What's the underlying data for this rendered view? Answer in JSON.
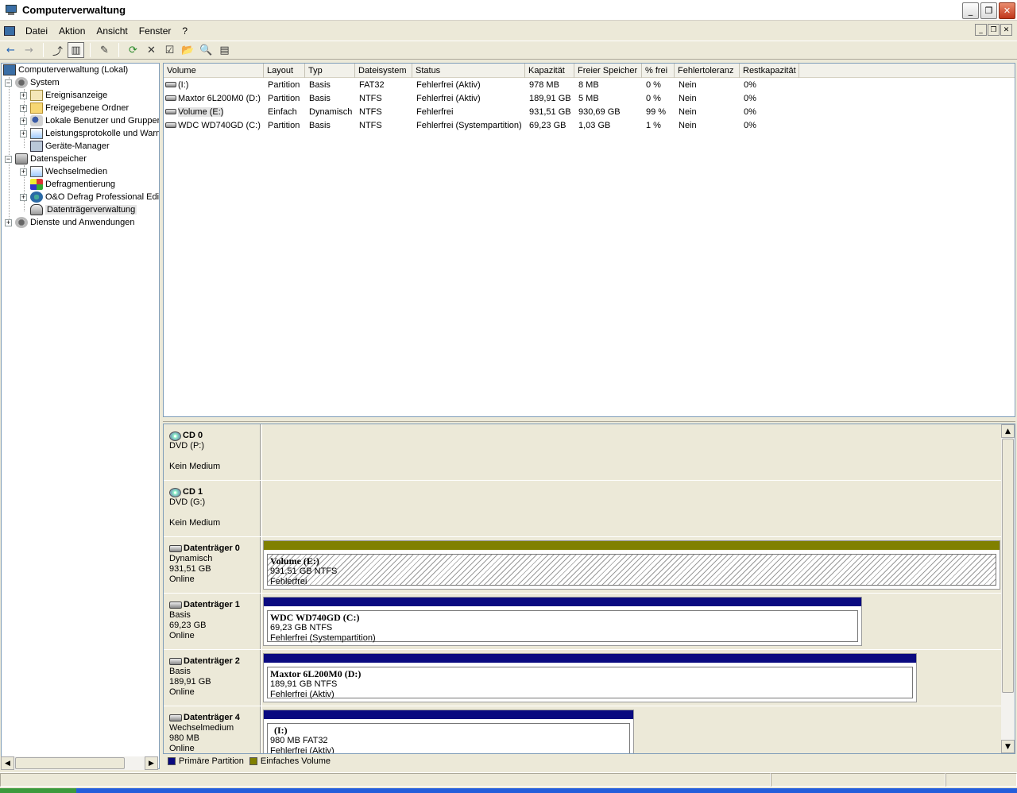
{
  "window": {
    "title": "Computerverwaltung",
    "minimize_glyph": "_",
    "restore_glyph": "❐",
    "close_glyph": "✕"
  },
  "menu": {
    "items": [
      "Datei",
      "Aktion",
      "Ansicht",
      "Fenster",
      "?"
    ],
    "mdi_minimize": "_",
    "mdi_restore": "❐",
    "mdi_close": "✕"
  },
  "toolbar": {
    "back": "←",
    "forward": "→",
    "up": "⤴",
    "show_tree": "▥",
    "properties": "✎",
    "refresh": "⟳",
    "delete": "✕",
    "props2": "☑",
    "open": "📂",
    "search": "🔍",
    "help": "▤"
  },
  "tree": {
    "root": "Computerverwaltung (Lokal)",
    "system": "System",
    "ereignis": "Ereignisanzeige",
    "freigegeben": "Freigegebene Ordner",
    "lokale": "Lokale Benutzer und Gruppen",
    "leistung": "Leistungsprotokolle und Warnungen",
    "geraete": "Geräte-Manager",
    "datenspeicher": "Datenspeicher",
    "wechsel": "Wechselmedien",
    "defrag": "Defragmentierung",
    "oo": "O&O Defrag Professional Edition",
    "dtv": "Datenträgerverwaltung",
    "dienste": "Dienste und Anwendungen",
    "plus": "+",
    "minus": "−"
  },
  "list": {
    "columns": [
      "Volume",
      "Layout",
      "Typ",
      "Dateisystem",
      "Status",
      "Kapazität",
      "Freier Speicher",
      "% frei",
      "Fehlertoleranz",
      "Restkapazität"
    ],
    "rows": [
      [
        "(I:)",
        "Partition",
        "Basis",
        "FAT32",
        "Fehlerfrei (Aktiv)",
        "978 MB",
        "8 MB",
        "0 %",
        "Nein",
        "0%"
      ],
      [
        "Maxtor 6L200M0 (D:)",
        "Partition",
        "Basis",
        "NTFS",
        "Fehlerfrei (Aktiv)",
        "189,91 GB",
        "5 MB",
        "0 %",
        "Nein",
        "0%"
      ],
      [
        "Volume (E:)",
        "Einfach",
        "Dynamisch",
        "NTFS",
        "Fehlerfrei",
        "931,51 GB",
        "930,69 GB",
        "99 %",
        "Nein",
        "0%"
      ],
      [
        "WDC WD740GD (C:)",
        "Partition",
        "Basis",
        "NTFS",
        "Fehlerfrei (Systempartition)",
        "69,23 GB",
        "1,03 GB",
        "1 %",
        "Nein",
        "0%"
      ]
    ]
  },
  "disks": [
    {
      "name": "CD 0",
      "line1": "DVD (P:)",
      "line2": "",
      "line3": "Kein Medium"
    },
    {
      "name": "CD 1",
      "line1": "DVD (G:)",
      "line2": "",
      "line3": "Kein Medium"
    },
    {
      "name": "Datenträger 0",
      "line1": "Dynamisch",
      "line2": "931,51 GB",
      "line3": "Online",
      "part": {
        "title": "Volume  (E:)",
        "size": "931,51 GB NTFS",
        "status": "Fehlerfrei"
      }
    },
    {
      "name": "Datenträger 1",
      "line1": "Basis",
      "line2": "69,23 GB",
      "line3": "Online",
      "part": {
        "title": "WDC WD740GD  (C:)",
        "size": "69,23 GB NTFS",
        "status": "Fehlerfrei (Systempartition)"
      }
    },
    {
      "name": "Datenträger 2",
      "line1": "Basis",
      "line2": "189,91 GB",
      "line3": "Online",
      "part": {
        "title": "Maxtor 6L200M0  (D:)",
        "size": "189,91 GB NTFS",
        "status": "Fehlerfrei (Aktiv)"
      }
    },
    {
      "name": "Datenträger 4",
      "line1": "Wechselmedium",
      "line2": "980 MB",
      "line3": "Online",
      "part": {
        "title": "(I:)",
        "size": "980 MB FAT32",
        "status": "Fehlerfrei (Aktiv)"
      }
    }
  ],
  "legend": {
    "primary": "Primäre Partition",
    "simple": "Einfaches Volume",
    "primary_color": "#0a0a80",
    "simple_color": "#808000"
  },
  "scroll": {
    "up": "▲",
    "down": "▼",
    "left": "◀",
    "right": "▶"
  }
}
